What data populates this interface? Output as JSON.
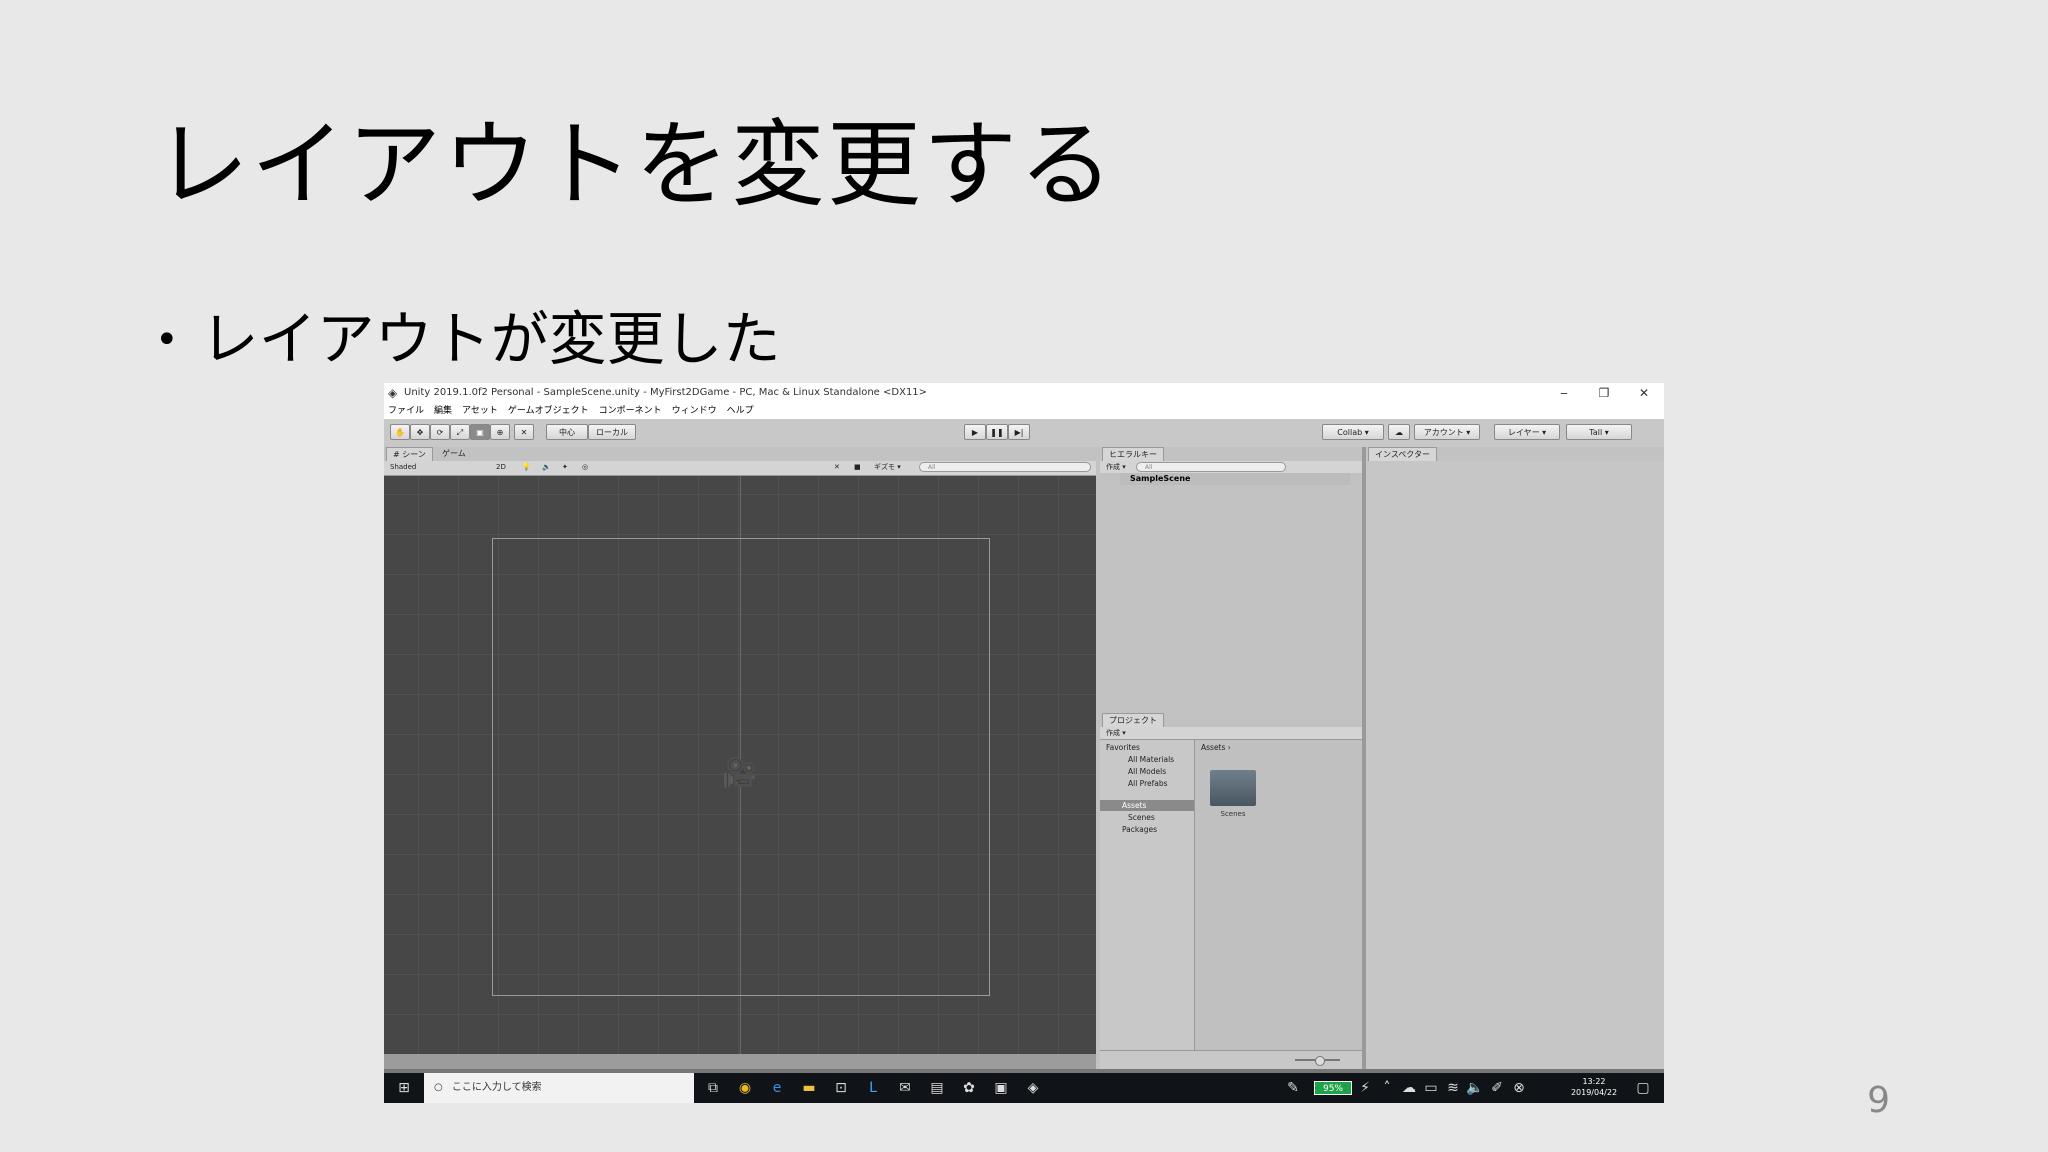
{
  "slide": {
    "title": "レイアウトを変更する",
    "bullet": "レイアウトが変更した",
    "page_number": "9"
  },
  "window": {
    "title": "Unity 2019.1.0f2 Personal - SampleScene.unity - MyFirst2DGame - PC, Mac & Linux Standalone <DX11>",
    "controls": [
      "‒",
      "❐",
      "✕"
    ]
  },
  "menu": [
    "ファイル",
    "編集",
    "アセット",
    "ゲームオブジェクト",
    "コンポーネント",
    "ウィンドウ",
    "ヘルプ"
  ],
  "toolbar": {
    "pivot": "中心",
    "space": "ローカル",
    "collab": "Collab ▾",
    "account": "アカウント ▾",
    "layers": "レイヤー ▾",
    "layout": "Tall ▾"
  },
  "scene": {
    "tab_scene": "# シーン",
    "tab_game": "ゲーム",
    "shading": "Shaded",
    "mode2d": "2D",
    "gizmos": "ギズモ ▾",
    "search_placeholder": "All"
  },
  "hierarchy": {
    "tab": "ヒエラルキー",
    "create": "作成 ▾",
    "search_placeholder": "All",
    "scene_name": "SampleScene"
  },
  "project": {
    "tab": "プロジェクト",
    "create": "作成 ▾",
    "favorites": "Favorites",
    "fav_items": [
      "All Materials",
      "All Models",
      "All Prefabs"
    ],
    "assets": "Assets",
    "scenes": "Scenes",
    "packages": "Packages",
    "breadcrumb": "Assets ›",
    "folder_label": "Scenes"
  },
  "inspector": {
    "tab": "インスペクター"
  },
  "taskbar": {
    "search_placeholder": "ここに入力して検索",
    "battery": "95%",
    "time": "13:22",
    "date": "2019/04/22"
  }
}
